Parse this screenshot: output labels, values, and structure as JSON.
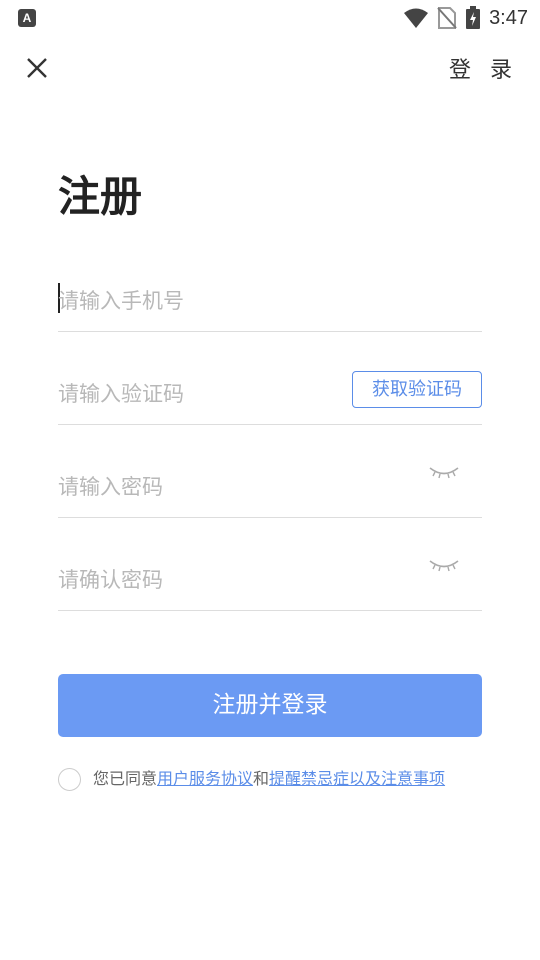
{
  "status_bar": {
    "time": "3:47",
    "app_badge": "A"
  },
  "header": {
    "login_label": "登 录"
  },
  "page": {
    "title": "注册"
  },
  "form": {
    "phone_placeholder": "请输入手机号",
    "code_placeholder": "请输入验证码",
    "get_code_label": "获取验证码",
    "password_placeholder": "请输入密码",
    "confirm_placeholder": "请确认密码",
    "submit_label": "注册并登录"
  },
  "agreement": {
    "prefix": "您已同意",
    "link1": "用户服务协议",
    "middle": "和",
    "link2": "提醒禁忌症以及注意事项"
  },
  "colors": {
    "accent": "#6b9af3",
    "link": "#5b8de8"
  }
}
